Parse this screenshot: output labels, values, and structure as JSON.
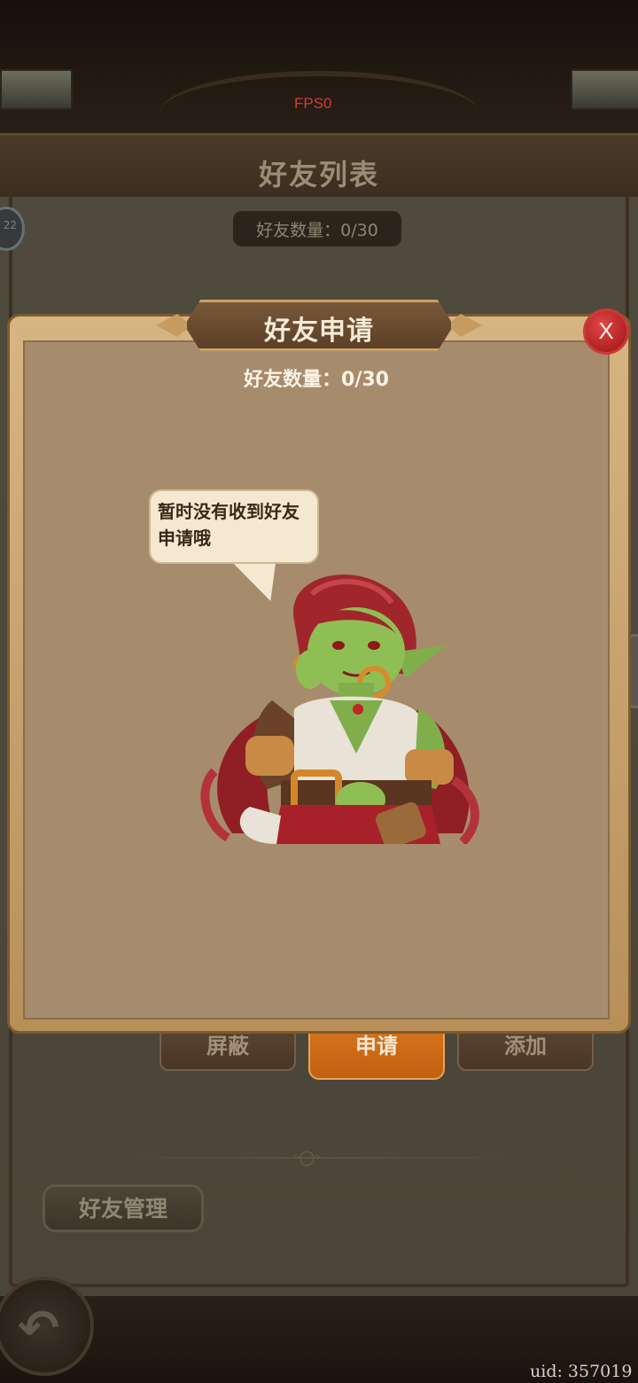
{
  "hud": {
    "fps": "FPS0"
  },
  "friend_list": {
    "title": "好友列表",
    "count_text": "好友数量：0/30",
    "edge_badge": "22",
    "tabs": [
      {
        "label": "屏蔽",
        "active": false
      },
      {
        "label": "申请",
        "active": true
      },
      {
        "label": "添加",
        "active": false
      }
    ],
    "manage_button": "好友管理"
  },
  "dialog": {
    "title": "好友申请",
    "close_label": "X",
    "count_text": "好友数量：0/30",
    "empty_message": "暂时没有收到好友申请哦",
    "character": "goblin-girl-mascot"
  },
  "footer": {
    "back_icon": "back-arrow-icon",
    "uid_text": "uid: 357019"
  },
  "colors": {
    "active_tab": "#d9781e",
    "close_button": "#c83b3b",
    "panel_parchment": "#a78b6d"
  }
}
